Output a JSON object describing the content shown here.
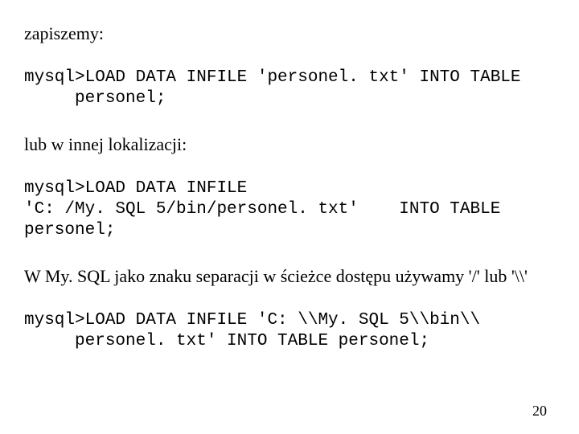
{
  "para1": "zapiszemy:",
  "code1": "mysql>LOAD DATA INFILE 'personel. txt' INTO TABLE\n     personel;",
  "para2": "lub w innej lokalizacji:",
  "code2": "mysql>LOAD DATA INFILE\n'C: /My. SQL 5/bin/personel. txt'    INTO TABLE\npersonel;",
  "para3": "W My. SQL jako znaku separacji w ścieżce dostępu używamy '/' lub '\\\\'",
  "code3": "mysql>LOAD DATA INFILE 'C: \\\\My. SQL 5\\\\bin\\\\\n     personel. txt' INTO TABLE personel;",
  "pagenum": "20"
}
